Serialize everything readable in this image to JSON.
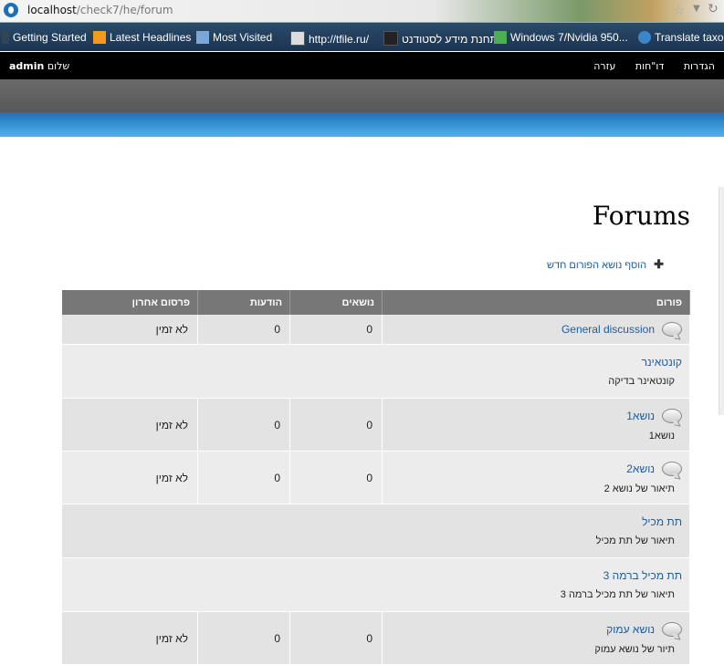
{
  "browser": {
    "url_host": "localhost",
    "url_path": "/check7/he/forum",
    "bookmarks": [
      {
        "label": "Getting Started",
        "icon": "page-icon"
      },
      {
        "label": "Latest Headlines",
        "icon": "rss-icon"
      },
      {
        "label": "Most Visited",
        "icon": "star-folder-icon"
      },
      {
        "label": "http://tfile.ru/",
        "icon": "tfile-icon"
      },
      {
        "label": "תחנת מידע לסטודנט",
        "icon": "page-icon"
      },
      {
        "label": "Windows 7/Nvidia 950...",
        "icon": "site-icon"
      },
      {
        "label": "Translate taxo",
        "icon": "drupal-icon"
      }
    ]
  },
  "toolbar": {
    "username": "admin",
    "greeting": "שלום",
    "menu": [
      "הגדרות",
      "דו\"חות",
      "עזרה"
    ]
  },
  "page": {
    "title": "Forums",
    "add_topic": "הוסף נושא הפורום חדש"
  },
  "table": {
    "headers": {
      "forum": "פורום",
      "topics": "נושאים",
      "posts": "הודעות",
      "last_post": "פרסום אחרון"
    },
    "rows": [
      {
        "title": "General discussion",
        "description": "",
        "topics": "0",
        "posts": "0",
        "last_post": "לא זמין",
        "container": false
      },
      {
        "title": "קונטאינר",
        "description": "קונטאינר בדיקה",
        "topics": "",
        "posts": "",
        "last_post": "",
        "container": true
      },
      {
        "title": "נושא1",
        "description": "נושא1",
        "topics": "0",
        "posts": "0",
        "last_post": "לא זמין",
        "container": false
      },
      {
        "title": "נושא2",
        "description": "תיאור של נושא 2",
        "topics": "0",
        "posts": "0",
        "last_post": "לא זמין",
        "container": false
      },
      {
        "title": "תת מכיל",
        "description": "תיאור של תת מכיל",
        "topics": "",
        "posts": "",
        "last_post": "",
        "container": true
      },
      {
        "title": "תת מכיל ברמה 3",
        "description": "תיאור של תת מכיל ברמה 3",
        "topics": "",
        "posts": "",
        "last_post": "",
        "container": true
      },
      {
        "title": "נושא עמוק",
        "description": "תיור של נושא עמוק",
        "topics": "0",
        "posts": "0",
        "last_post": "לא זמין",
        "container": false
      }
    ]
  }
}
